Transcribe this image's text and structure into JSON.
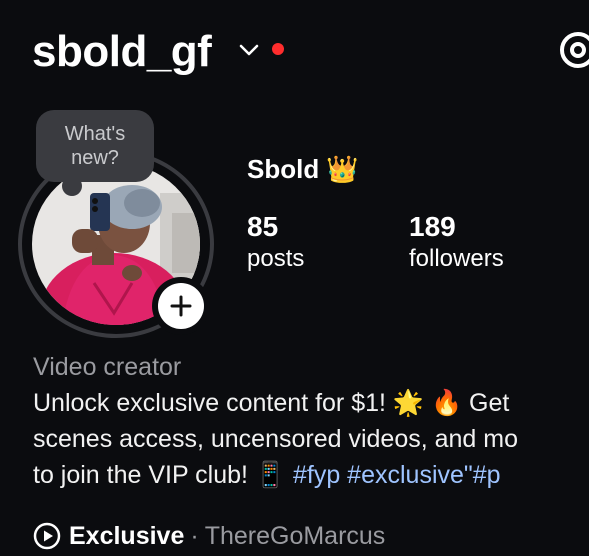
{
  "header": {
    "username": "sbold_gf",
    "threads_icon": "threads-icon",
    "dropdown_icon": "chevron-down-icon",
    "notification_color": "#ff2d2d"
  },
  "note": {
    "line1": "What's",
    "line2": "new?"
  },
  "profile": {
    "display_name": "Sbold 👑",
    "stats": [
      {
        "value": "85",
        "label": "posts"
      },
      {
        "value": "189",
        "label": "followers"
      }
    ]
  },
  "bio": {
    "category": "Video creator",
    "line1": "Unlock exclusive content for $1! 🌟 🔥 Get",
    "line2": "scenes access, uncensored videos, and mo",
    "line3_text": "to join the VIP club! 📱 ",
    "line3_tags": "#fyp #exclusive\"#p"
  },
  "link": {
    "icon": "play-circle-icon",
    "title": "Exclusive",
    "separator": "·",
    "subtitle": "ThereGoMarcus"
  },
  "colors": {
    "background": "#0b0c0f",
    "hashtag": "#9fc4ff",
    "muted": "#9a9ba0"
  }
}
